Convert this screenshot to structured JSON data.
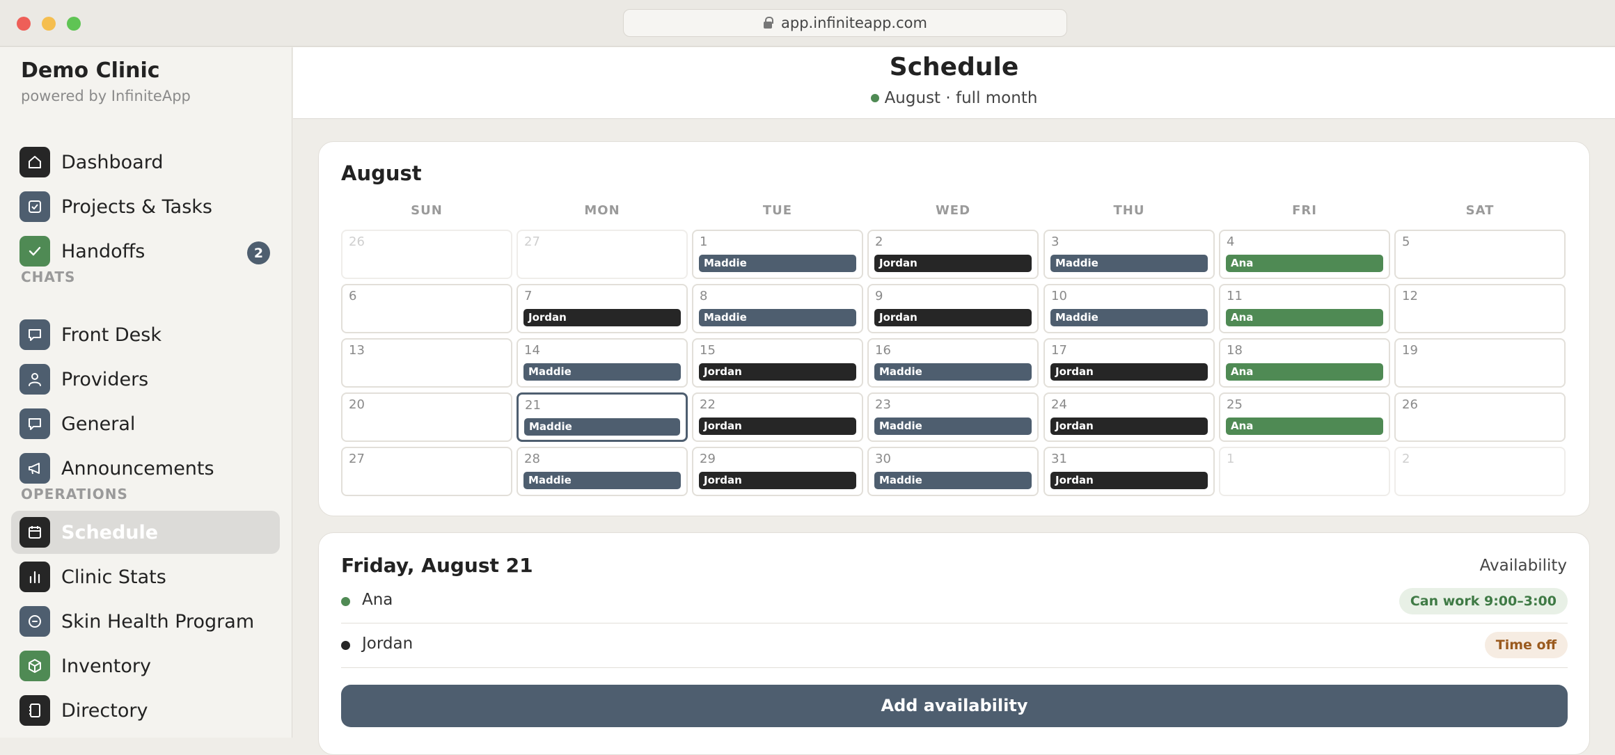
{
  "browser": {
    "url": "app.infiniteapp.com"
  },
  "sidebar": {
    "brand": "Demo Clinic",
    "powered_by": "powered by InfiniteApp",
    "top_items": [
      {
        "label": "Dashboard",
        "icon": "home-icon"
      },
      {
        "label": "Projects & Tasks",
        "icon": "checkbox-icon"
      },
      {
        "label": "Handoffs",
        "icon": "check-icon",
        "badge": "2"
      }
    ],
    "chats_label": "CHATS",
    "chat_items": [
      {
        "label": "Front Desk",
        "icon": "chat-bubble-icon"
      },
      {
        "label": "Providers",
        "icon": "person-icon"
      },
      {
        "label": "General",
        "icon": "chat-bubble-icon"
      },
      {
        "label": "Announcements",
        "icon": "megaphone-icon"
      }
    ],
    "operations_label": "OPERATIONS",
    "ops_items": [
      {
        "label": "Schedule",
        "icon": "calendar-icon",
        "active": true
      },
      {
        "label": "Clinic Stats",
        "icon": "bar-chart-icon"
      },
      {
        "label": "Skin Health Program",
        "icon": "circle-dash-icon"
      },
      {
        "label": "Inventory",
        "icon": "box-icon"
      },
      {
        "label": "Directory",
        "icon": "notebook-icon"
      }
    ]
  },
  "header": {
    "title": "Schedule",
    "subtitle": "August · full month"
  },
  "calendar": {
    "month": "August",
    "weekdays": [
      "SUN",
      "MON",
      "TUE",
      "WED",
      "THU",
      "FRI",
      "SAT"
    ],
    "weeks": [
      [
        {
          "day": "26",
          "other": true
        },
        {
          "day": "27",
          "other": true
        },
        {
          "day": "1",
          "shift": "Maddie",
          "color": "slate"
        },
        {
          "day": "2",
          "shift": "Jordan",
          "color": "dark"
        },
        {
          "day": "3",
          "shift": "Maddie",
          "color": "slate"
        },
        {
          "day": "4",
          "shift": "Ana",
          "color": "green"
        },
        {
          "day": "5"
        }
      ],
      [
        {
          "day": "6"
        },
        {
          "day": "7",
          "shift": "Jordan",
          "color": "dark"
        },
        {
          "day": "8",
          "shift": "Maddie",
          "color": "slate"
        },
        {
          "day": "9",
          "shift": "Jordan",
          "color": "dark"
        },
        {
          "day": "10",
          "shift": "Maddie",
          "color": "slate"
        },
        {
          "day": "11",
          "shift": "Ana",
          "color": "green"
        },
        {
          "day": "12"
        }
      ],
      [
        {
          "day": "13"
        },
        {
          "day": "14",
          "shift": "Maddie",
          "color": "slate"
        },
        {
          "day": "15",
          "shift": "Jordan",
          "color": "dark"
        },
        {
          "day": "16",
          "shift": "Maddie",
          "color": "slate"
        },
        {
          "day": "17",
          "shift": "Jordan",
          "color": "dark"
        },
        {
          "day": "18",
          "shift": "Ana",
          "color": "green"
        },
        {
          "day": "19"
        }
      ],
      [
        {
          "day": "20"
        },
        {
          "day": "21",
          "shift": "Maddie",
          "color": "slate",
          "today": true
        },
        {
          "day": "22",
          "shift": "Jordan",
          "color": "dark"
        },
        {
          "day": "23",
          "shift": "Maddie",
          "color": "slate"
        },
        {
          "day": "24",
          "shift": "Jordan",
          "color": "dark"
        },
        {
          "day": "25",
          "shift": "Ana",
          "color": "green"
        },
        {
          "day": "26"
        }
      ],
      [
        {
          "day": "27"
        },
        {
          "day": "28",
          "shift": "Maddie",
          "color": "slate"
        },
        {
          "day": "29",
          "shift": "Jordan",
          "color": "dark"
        },
        {
          "day": "30",
          "shift": "Maddie",
          "color": "slate"
        },
        {
          "day": "31",
          "shift": "Jordan",
          "color": "dark"
        },
        {
          "day": "1",
          "other": true
        },
        {
          "day": "2",
          "other": true
        }
      ]
    ]
  },
  "day_detail": {
    "title": "Friday, August 21",
    "availability_label": "Availability",
    "people": [
      {
        "name": "Ana",
        "status": "Can work 9:00–3:00",
        "dot_color": "#4f8a54",
        "status_type": "green"
      },
      {
        "name": "Jordan",
        "status": "Time off",
        "dot_color": "#262626",
        "status_type": "orange"
      }
    ],
    "add_button": "Add availability"
  },
  "colors": {
    "slate": "#4e5e6f",
    "dark": "#262626",
    "green": "#4f8a54"
  }
}
